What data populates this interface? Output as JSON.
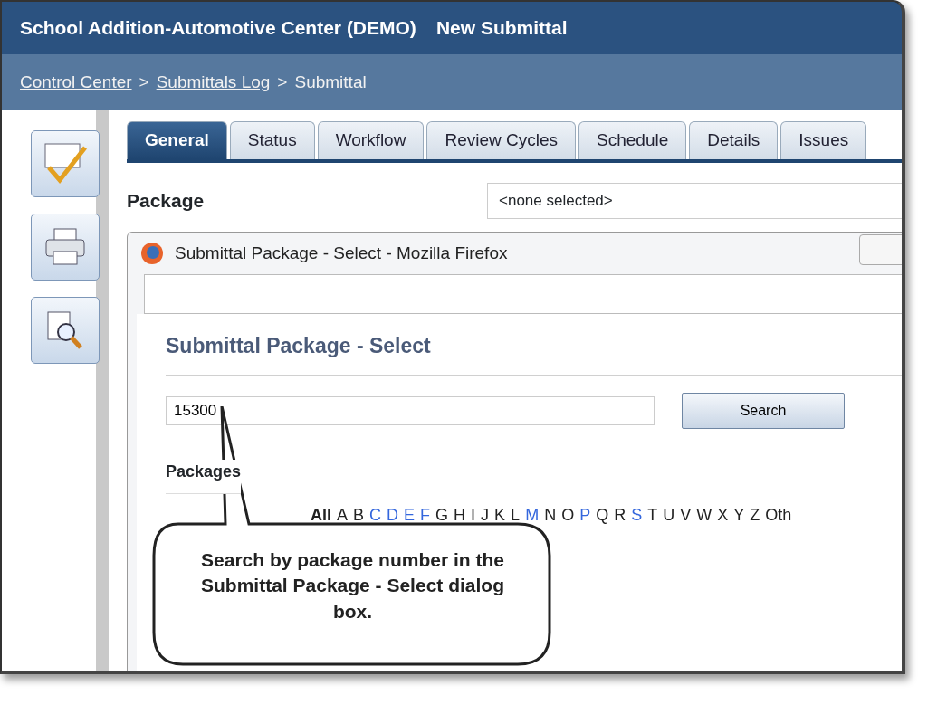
{
  "window": {
    "title": "School Addition-Automotive Center (DEMO)",
    "subtitle": "New Submittal"
  },
  "breadcrumb": {
    "separator": ">",
    "items": [
      {
        "label": "Control Center",
        "link": true
      },
      {
        "label": "Submittals Log",
        "link": true
      },
      {
        "label": "Submittal",
        "link": false
      }
    ]
  },
  "tabs": [
    {
      "label": "General",
      "selected": true
    },
    {
      "label": "Status",
      "selected": false
    },
    {
      "label": "Workflow",
      "selected": false
    },
    {
      "label": "Review Cycles",
      "selected": false
    },
    {
      "label": "Schedule",
      "selected": false
    },
    {
      "label": "Details",
      "selected": false
    },
    {
      "label": "Issues",
      "selected": false
    }
  ],
  "package": {
    "label": "Package",
    "value": "<none selected>"
  },
  "dialog": {
    "window_title": "Submittal Package - Select - Mozilla Firefox",
    "heading": "Submittal Package - Select",
    "search": {
      "value": "15300"
    },
    "search_button": "Search",
    "section": "Packages",
    "letters": [
      {
        "label": "All",
        "kind": "all",
        "linked": false
      },
      {
        "label": "A",
        "kind": "letter",
        "linked": false
      },
      {
        "label": "B",
        "kind": "letter",
        "linked": false
      },
      {
        "label": "C",
        "kind": "letter",
        "linked": true
      },
      {
        "label": "D",
        "kind": "letter",
        "linked": true
      },
      {
        "label": "E",
        "kind": "letter",
        "linked": true
      },
      {
        "label": "F",
        "kind": "letter",
        "linked": true
      },
      {
        "label": "G",
        "kind": "letter",
        "linked": false
      },
      {
        "label": "H",
        "kind": "letter",
        "linked": false
      },
      {
        "label": "I",
        "kind": "letter",
        "linked": false
      },
      {
        "label": "J",
        "kind": "letter",
        "linked": false
      },
      {
        "label": "K",
        "kind": "letter",
        "linked": false
      },
      {
        "label": "L",
        "kind": "letter",
        "linked": false
      },
      {
        "label": "M",
        "kind": "letter",
        "linked": true
      },
      {
        "label": "N",
        "kind": "letter",
        "linked": false
      },
      {
        "label": "O",
        "kind": "letter",
        "linked": false
      },
      {
        "label": "P",
        "kind": "letter",
        "linked": true
      },
      {
        "label": "Q",
        "kind": "letter",
        "linked": false
      },
      {
        "label": "R",
        "kind": "letter",
        "linked": false
      },
      {
        "label": "S",
        "kind": "letter",
        "linked": true
      },
      {
        "label": "T",
        "kind": "letter",
        "linked": false
      },
      {
        "label": "U",
        "kind": "letter",
        "linked": false
      },
      {
        "label": "V",
        "kind": "letter",
        "linked": false
      },
      {
        "label": "W",
        "kind": "letter",
        "linked": false
      },
      {
        "label": "X",
        "kind": "letter",
        "linked": false
      },
      {
        "label": "Y",
        "kind": "letter",
        "linked": false
      },
      {
        "label": "Z",
        "kind": "letter",
        "linked": false
      },
      {
        "label": "Oth",
        "kind": "other",
        "linked": false
      }
    ]
  },
  "callout": "Search by package number in the Submittal Package - Select dialog box."
}
